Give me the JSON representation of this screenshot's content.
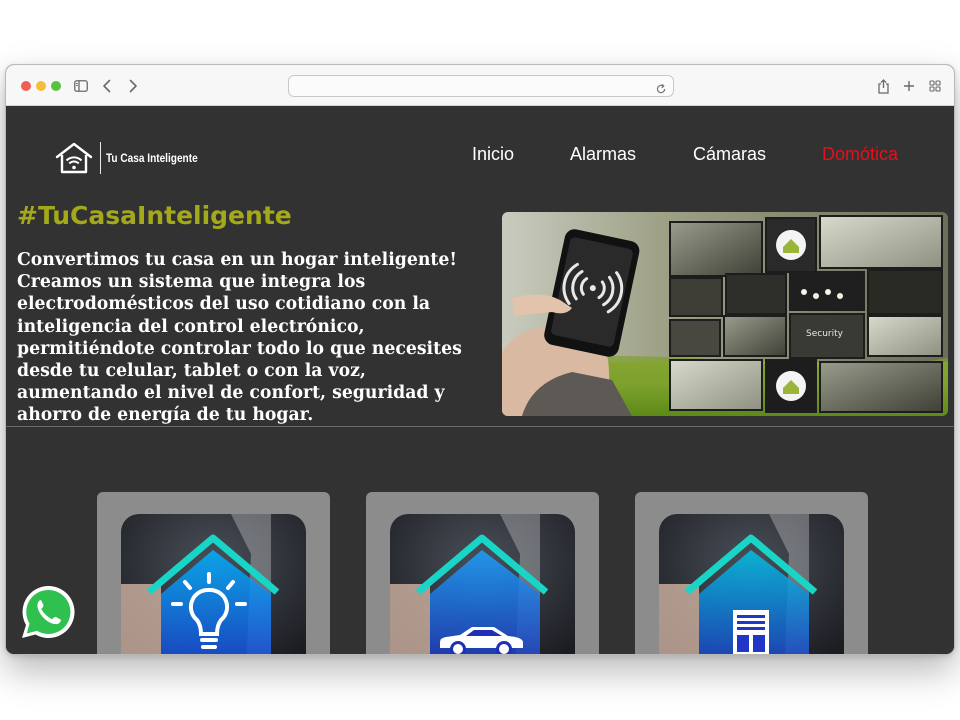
{
  "browser": {
    "address": "",
    "icons": [
      "sidebar-icon",
      "back-icon",
      "forward-icon",
      "reload-icon",
      "share-icon",
      "new-tab-icon",
      "tab-overview-icon"
    ]
  },
  "site": {
    "brand": "Tu Casa Inteligente",
    "nav": [
      {
        "label": "Inicio"
      },
      {
        "label": "Alarmas"
      },
      {
        "label": "Cámaras"
      },
      {
        "label": "Domótica",
        "active": true
      }
    ],
    "hashtag": "#TuCasaInteligente",
    "intro": "Convertimos tu casa en un hogar inteligente! Creamos un sistema que integra los electrodomésticos del uso cotidiano con la inteligencia del control electrónico, permitiéndote controlar todo lo que necesites desde tu celular, tablet o con la voz, aumentando el nivel de confort, seguridad y ahorro de energía de tu hogar.",
    "hero_security_label": "Security",
    "cards": [
      {
        "icon": "lightbulb-icon"
      },
      {
        "icon": "car-icon"
      },
      {
        "icon": "window-blinds-icon"
      }
    ],
    "whatsapp_icon": "whatsapp-icon"
  },
  "colors": {
    "background": "#323232",
    "hashtag": "#a4a91a",
    "active_nav": "#e5101c",
    "card": "#8c8c8c"
  }
}
